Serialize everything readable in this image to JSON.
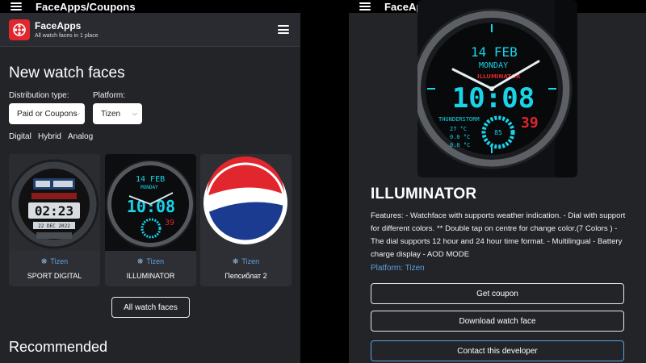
{
  "app_bar": {
    "title": "FaceApps/Coupons"
  },
  "site": {
    "name": "FaceApps",
    "tagline": "All watch faces in 1 place"
  },
  "new_section": {
    "title": "New watch faces",
    "distribution_label": "Distribution type:",
    "distribution_value": "Paid or Coupons",
    "platform_label": "Platform:",
    "platform_value": "Tizen",
    "filters": [
      "Digital",
      "Hybrid",
      "Analog"
    ]
  },
  "cards": [
    {
      "name": "SPORT DIGITAL",
      "platform": "Tizen"
    },
    {
      "name": "ILLUMINATOR",
      "platform": "Tizen"
    },
    {
      "name": "Пепсиблат 2",
      "platform": "Tizen"
    }
  ],
  "all_button": "All watch faces",
  "recommended_title": "Recommended",
  "watch_face_texts": {
    "date": "14 FEB",
    "day": "MONDAY",
    "brand": "ILLUMINATOR",
    "time": "10:08",
    "seconds": "39",
    "weather": "THUNDERSTORM",
    "temp1": "27 °C",
    "temp2": "0.0 °C",
    "temp3": "0.0 °C",
    "battery": "85"
  },
  "sport_texts": {
    "time": "02:23",
    "date": "22 DEC 2022"
  },
  "detail": {
    "title": "ILLUMINATOR",
    "description": "Features: - Watchface with supports weather indication. - Dial with support for different colors. ** Double tap on centre for change color.(7 Colors ) - The dial supports 12 hour and 24 hour time format. - Multilingual - Battery charge display - AOD MODE",
    "platform": "Platform: Tizen",
    "buttons": {
      "coupon": "Get coupon",
      "download": "Download watch face",
      "contact": "Contact this developer"
    }
  },
  "colors": {
    "accent_blue": "#5aa1e3",
    "brand_red": "#e1262d",
    "watch_cyan": "#19d4e8",
    "background": "#232428"
  }
}
